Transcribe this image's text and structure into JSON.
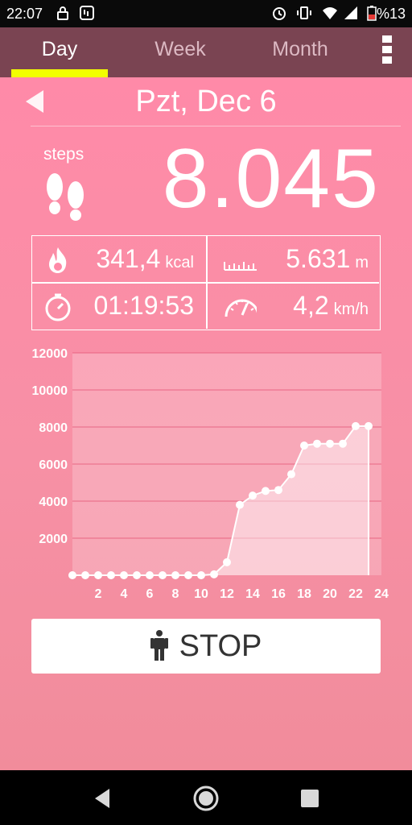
{
  "status_bar": {
    "time": "22:07",
    "battery_text": "%13",
    "icons": [
      "lock-icon",
      "app-notification-icon",
      "alarm-icon",
      "vibrate-icon",
      "wifi-icon",
      "signal-icon",
      "battery-low-icon"
    ]
  },
  "tabs": [
    {
      "label": "Day",
      "active": true
    },
    {
      "label": "Week",
      "active": false
    },
    {
      "label": "Month",
      "active": false
    }
  ],
  "header": {
    "date": "Pzt, Dec 6"
  },
  "steps": {
    "label": "steps",
    "value": "8.045"
  },
  "stats": {
    "calories": {
      "value": "341,4",
      "unit": "kcal",
      "icon": "flame-icon"
    },
    "distance": {
      "value": "5.631",
      "unit": "m",
      "icon": "ruler-icon"
    },
    "duration": {
      "value": "01:19:53",
      "unit": "",
      "icon": "stopwatch-icon"
    },
    "speed": {
      "value": "4,2",
      "unit": "km/h",
      "icon": "speedometer-icon"
    }
  },
  "stop_button": {
    "label": "STOP",
    "icon": "person-walking-icon"
  },
  "colors": {
    "accent_underline": "#f2ff00",
    "tabbar": "#7a4452",
    "background": "#ff8aa8"
  },
  "chart_data": {
    "type": "area",
    "x": [
      0,
      1,
      2,
      3,
      4,
      5,
      6,
      7,
      8,
      9,
      10,
      11,
      12,
      13,
      14,
      15,
      16,
      17,
      18,
      19,
      20,
      21,
      22,
      23
    ],
    "values": [
      0,
      0,
      0,
      0,
      0,
      0,
      0,
      0,
      0,
      0,
      0,
      50,
      700,
      3800,
      4300,
      4550,
      4600,
      5450,
      7000,
      7100,
      7100,
      7100,
      8050,
      8050
    ],
    "xticks": [
      "2",
      "4",
      "6",
      "8",
      "10",
      "12",
      "14",
      "16",
      "18",
      "20",
      "22",
      "24"
    ],
    "yticks": [
      "2000",
      "4000",
      "6000",
      "8000",
      "10000",
      "12000"
    ],
    "xlim": [
      0,
      24
    ],
    "ylim": [
      0,
      12000
    ],
    "grid": true,
    "title": "",
    "xlabel": "",
    "ylabel": ""
  }
}
